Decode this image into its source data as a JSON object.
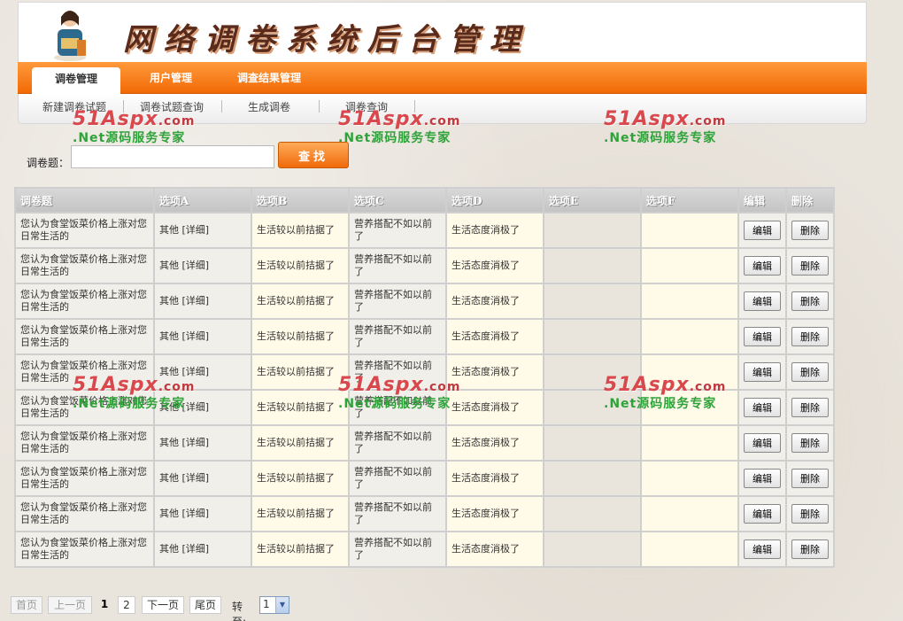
{
  "header": {
    "site_title": "网络调卷系统后台管理"
  },
  "nav": {
    "tabs": [
      {
        "label": "调卷管理",
        "active": true
      },
      {
        "label": "用户管理",
        "active": false
      },
      {
        "label": "调查结果管理",
        "active": false
      }
    ]
  },
  "subnav": {
    "items": [
      "新建调卷试题",
      "调卷试题查询",
      "生成调卷",
      "调卷查询"
    ]
  },
  "watermark": {
    "logo": "51Aspx",
    "domain": ".com",
    "slogan": ".Net源码服务专家"
  },
  "search": {
    "label": "调卷题：",
    "value": "",
    "button": "查找"
  },
  "table": {
    "headers": [
      "调卷题",
      "选项A",
      "选项B",
      "选项C",
      "选项D",
      "选项E",
      "选项F",
      "编辑",
      "删除"
    ],
    "rows": [
      {
        "q": "您认为食堂饭菜价格上涨对您日常生活的",
        "a": "其他 [详细]",
        "b": "生活较以前拮据了",
        "c": "营养搭配不如以前了",
        "d": "生活态度消极了",
        "e": "",
        "f": "",
        "edit": "编辑",
        "del": "删除"
      },
      {
        "q": "您认为食堂饭菜价格上涨对您日常生活的",
        "a": "其他 [详细]",
        "b": "生活较以前拮据了",
        "c": "营养搭配不如以前了",
        "d": "生活态度消极了",
        "e": "",
        "f": "",
        "edit": "编辑",
        "del": "删除"
      },
      {
        "q": "您认为食堂饭菜价格上涨对您日常生活的",
        "a": "其他 [详细]",
        "b": "生活较以前拮据了",
        "c": "营养搭配不如以前了",
        "d": "生活态度消极了",
        "e": "",
        "f": "",
        "edit": "编辑",
        "del": "删除"
      },
      {
        "q": "您认为食堂饭菜价格上涨对您日常生活的",
        "a": "其他 [详细]",
        "b": "生活较以前拮据了",
        "c": "营养搭配不如以前了",
        "d": "生活态度消极了",
        "e": "",
        "f": "",
        "edit": "编辑",
        "del": "删除"
      },
      {
        "q": "您认为食堂饭菜价格上涨对您日常生活的",
        "a": "其他 [详细]",
        "b": "生活较以前拮据了",
        "c": "营养搭配不如以前了",
        "d": "生活态度消极了",
        "e": "",
        "f": "",
        "edit": "编辑",
        "del": "删除"
      },
      {
        "q": "您认为食堂饭菜价格上涨对您日常生活的",
        "a": "其他 [详细]",
        "b": "生活较以前拮据了",
        "c": "营养搭配不如以前了",
        "d": "生活态度消极了",
        "e": "",
        "f": "",
        "edit": "编辑",
        "del": "删除"
      },
      {
        "q": "您认为食堂饭菜价格上涨对您日常生活的",
        "a": "其他 [详细]",
        "b": "生活较以前拮据了",
        "c": "营养搭配不如以前了",
        "d": "生活态度消极了",
        "e": "",
        "f": "",
        "edit": "编辑",
        "del": "删除"
      },
      {
        "q": "您认为食堂饭菜价格上涨对您日常生活的",
        "a": "其他 [详细]",
        "b": "生活较以前拮据了",
        "c": "营养搭配不如以前了",
        "d": "生活态度消极了",
        "e": "",
        "f": "",
        "edit": "编辑",
        "del": "删除"
      },
      {
        "q": "您认为食堂饭菜价格上涨对您日常生活的",
        "a": "其他 [详细]",
        "b": "生活较以前拮据了",
        "c": "营养搭配不如以前了",
        "d": "生活态度消极了",
        "e": "",
        "f": "",
        "edit": "编辑",
        "del": "删除"
      },
      {
        "q": "您认为食堂饭菜价格上涨对您日常生活的",
        "a": "其他 [详细]",
        "b": "生活较以前拮据了",
        "c": "营养搭配不如以前了",
        "d": "生活态度消极了",
        "e": "",
        "f": "",
        "edit": "编辑",
        "del": "删除"
      }
    ]
  },
  "pager": {
    "first": "首页",
    "prev": "上一页",
    "pages": [
      "1",
      "2"
    ],
    "current": "1",
    "next": "下一页",
    "last": "尾页",
    "goto_label": "转至:",
    "goto_value": "1"
  },
  "colors": {
    "nav_orange": "#f26a05",
    "watermark_red": "#d9484c",
    "watermark_green": "#2fa23a"
  }
}
